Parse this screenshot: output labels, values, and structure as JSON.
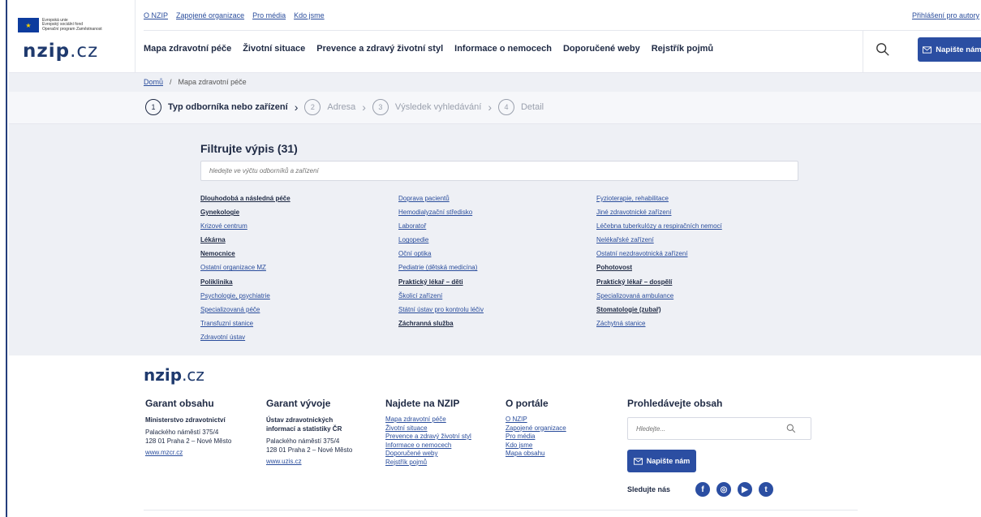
{
  "eu": {
    "line1": "Evropská unie",
    "line2": "Evropský sociální fond",
    "line3": "Operační program Zaměstnanost"
  },
  "logo": {
    "brand": "nzip",
    "tld": ".cz"
  },
  "topnav": [
    "O NZIP",
    "Zapojené organizace",
    "Pro média",
    "Kdo jsme"
  ],
  "login": "Přihlášení pro autory",
  "mainnav": [
    "Mapa zdravotní péče",
    "Životní situace",
    "Prevence a zdravý životní styl",
    "Informace o nemocech",
    "Doporučené weby",
    "Rejstřík pojmů"
  ],
  "write_button": "Napište nám",
  "breadcrumb": {
    "home": "Domů",
    "current": "Mapa zdravotní péče"
  },
  "steps": [
    {
      "num": "1",
      "label": "Typ odborníka nebo zařízení"
    },
    {
      "num": "2",
      "label": "Adresa"
    },
    {
      "num": "3",
      "label": "Výsledek vyhledávání"
    },
    {
      "num": "4",
      "label": "Detail"
    }
  ],
  "filter": {
    "title": "Filtrujte výpis (31)",
    "placeholder": "hledejte ve výčtu odborníků a zařízení"
  },
  "columns": [
    [
      {
        "label": "Dlouhodobá a následná péče",
        "bold": true
      },
      {
        "label": "Gynekologie",
        "bold": true
      },
      {
        "label": "Krizové centrum",
        "bold": false
      },
      {
        "label": "Lékárna",
        "bold": true
      },
      {
        "label": "Nemocnice",
        "bold": true
      },
      {
        "label": "Ostatní organizace MZ",
        "bold": false
      },
      {
        "label": "Poliklinika",
        "bold": true
      },
      {
        "label": "Psychologie, psychiatrie",
        "bold": false
      },
      {
        "label": "Specializovaná péče",
        "bold": false
      },
      {
        "label": "Transfuzní stanice",
        "bold": false
      },
      {
        "label": "Zdravotní ústav",
        "bold": false
      }
    ],
    [
      {
        "label": "Doprava pacientů",
        "bold": false
      },
      {
        "label": "Hemodialyzační středisko",
        "bold": false
      },
      {
        "label": "Laboratoř",
        "bold": false
      },
      {
        "label": "Logopedie",
        "bold": false
      },
      {
        "label": "Oční optika",
        "bold": false
      },
      {
        "label": "Pediatrie (dětská medicína)",
        "bold": false
      },
      {
        "label": "Praktický lékař – děti",
        "bold": true
      },
      {
        "label": "Školicí zařízení",
        "bold": false
      },
      {
        "label": "Státní ústav pro kontrolu léčiv",
        "bold": false
      },
      {
        "label": "Záchranná služba",
        "bold": true
      }
    ],
    [
      {
        "label": "Fyzioterapie, rehabilitace",
        "bold": false
      },
      {
        "label": "Jiné zdravotnické zařízení",
        "bold": false
      },
      {
        "label": "Léčebna tuberkulózy a respiračních nemocí",
        "bold": false
      },
      {
        "label": "Nelékařské zařízení",
        "bold": false
      },
      {
        "label": "Ostatní nezdravotnická zařízení",
        "bold": false
      },
      {
        "label": "Pohotovost",
        "bold": true
      },
      {
        "label": "Praktický lékař – dospělí",
        "bold": true
      },
      {
        "label": "Specializovaná ambulance",
        "bold": false
      },
      {
        "label": "Stomatologie (zubař)",
        "bold": true
      },
      {
        "label": "Záchytná stanice",
        "bold": false
      }
    ]
  ],
  "footer": {
    "garant_obsahu": {
      "title": "Garant obsahu",
      "org": "Ministerstvo zdravotnictví",
      "addr1": "Palackého náměstí 375/4",
      "addr2": "128 01 Praha 2 – Nové Město",
      "link": "www.mzcr.cz"
    },
    "garant_vyvoje": {
      "title": "Garant vývoje",
      "org1": "Ústav zdravotnických",
      "org2": "informací a statistiky ČR",
      "addr1": "Palackého náměstí 375/4",
      "addr2": "128 01 Praha 2 – Nové Město",
      "link": "www.uzis.cz"
    },
    "najdete": {
      "title": "Najdete na NZIP",
      "links": [
        "Mapa zdravotní péče",
        "Životní situace",
        "Prevence a zdravý životní styl",
        "Informace o nemocech",
        "Doporučené weby",
        "Rejstřík pojmů"
      ]
    },
    "portal": {
      "title": "O portále",
      "links": [
        "O NZIP",
        "Zapojené organizace",
        "Pro média",
        "Kdo jsme",
        "Mapa obsahu"
      ]
    },
    "search": {
      "title": "Prohledávejte obsah",
      "placeholder": "Hledejte..."
    },
    "write_button": "Napište nám",
    "follow": "Sledujte nás",
    "social_icons": [
      "facebook-icon",
      "instagram-icon",
      "youtube-icon",
      "twitter-icon"
    ]
  }
}
